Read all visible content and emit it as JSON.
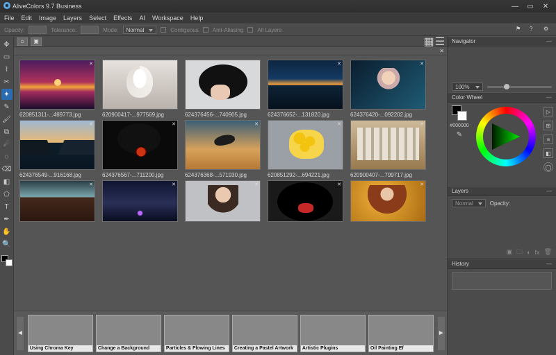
{
  "window": {
    "title": "AliveColors 9.7 Business"
  },
  "menu": [
    "File",
    "Edit",
    "Image",
    "Layers",
    "Select",
    "Effects",
    "AI",
    "Workspace",
    "Help"
  ],
  "optbar": {
    "opacity_label": "Opacity:",
    "tolerance_label": "Tolerance:",
    "mode_label": "Mode:",
    "mode_value": "Normal",
    "contiguous": "Contiguous",
    "antialias": "Anti-Aliasing",
    "alllayers": "All Layers"
  },
  "tools": [
    "move",
    "crop",
    "select-rect",
    "lasso",
    "wand",
    "eyedrop",
    "paint",
    "clone",
    "smudge",
    "blur",
    "eraser",
    "gradient",
    "shape",
    "text",
    "pen",
    "hand",
    "zoom"
  ],
  "gallery": [
    [
      {
        "file": "620851311-...489773.jpg",
        "img": "sunset"
      },
      {
        "file": "620900417-...977569.jpg",
        "img": "ballerina"
      },
      {
        "file": "624376456-...740905.jpg",
        "img": "hat"
      },
      {
        "file": "624376652-...131820.jpg",
        "img": "lake"
      },
      {
        "file": "624376420-...092202.jpg",
        "img": "glam"
      }
    ],
    [
      {
        "file": "624376549-...916168.jpg",
        "img": "mtn"
      },
      {
        "file": "624376567-...711200.jpg",
        "img": "rose"
      },
      {
        "file": "624376368-...571930.jpg",
        "img": "bird"
      },
      {
        "file": "620851292-...694221.jpg",
        "img": "sunfl"
      },
      {
        "file": "620900407-...799717.jpg",
        "img": "columns"
      }
    ],
    [
      {
        "file": "",
        "img": "barn"
      },
      {
        "file": "",
        "img": "storm"
      },
      {
        "file": "",
        "img": "portrait"
      },
      {
        "file": "",
        "img": "hat2"
      },
      {
        "file": "",
        "img": "gold"
      }
    ]
  ],
  "tutorials": [
    {
      "label": "Using Chroma Key",
      "cls": "c-green"
    },
    {
      "label": "Change a Background",
      "cls": "c-beach"
    },
    {
      "label": "Particles & Flowing Lines",
      "cls": "c-part"
    },
    {
      "label": "Creating a Pastel Artwork",
      "cls": "c-pastel"
    },
    {
      "label": "Artistic Plugins",
      "cls": "c-plugins"
    },
    {
      "label": "Oil Painting Ef",
      "cls": "c-oil"
    }
  ],
  "panels": {
    "navigator": "Navigator",
    "zoom": "100%",
    "colorwheel": "Color Wheel",
    "hex": "#000000",
    "layers": "Layers",
    "blend": "Normal",
    "opacity_label": "Opacity:",
    "history": "History"
  }
}
